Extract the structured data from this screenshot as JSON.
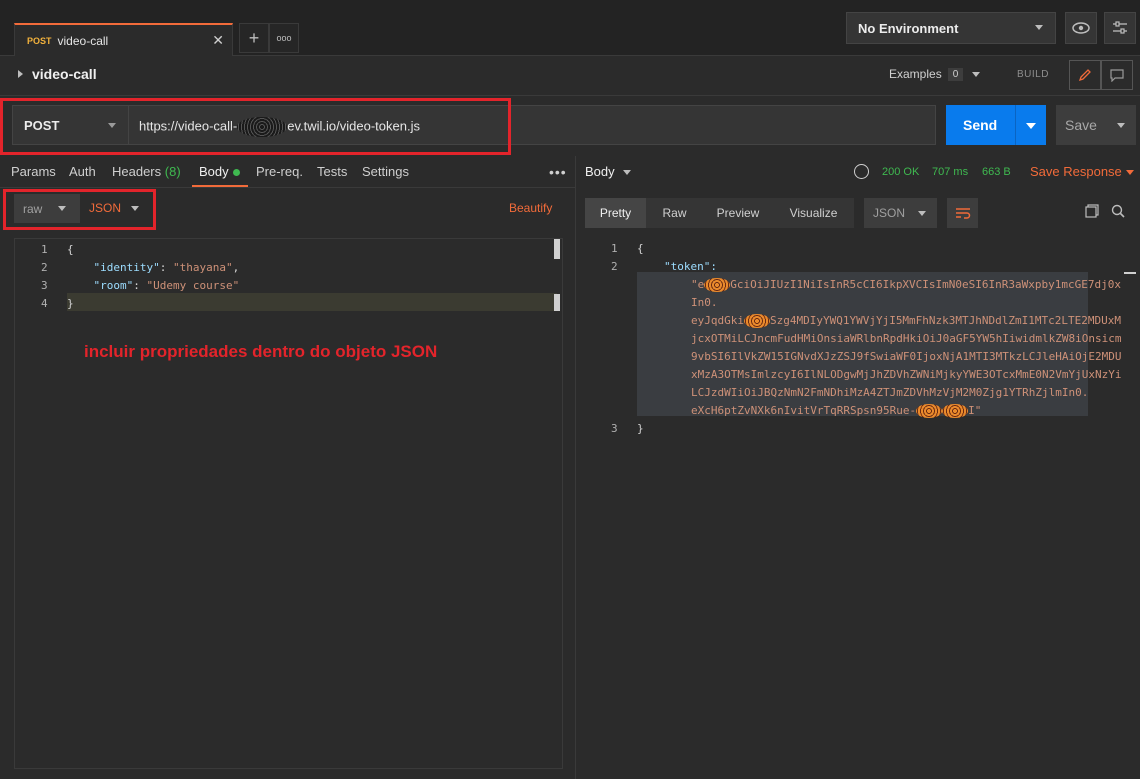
{
  "tabbar": {
    "tab_method": "POST",
    "tab_name": "video-call",
    "close_glyph": "✕",
    "new_tab_glyph": "+",
    "more_glyph": "ooo",
    "environment": "No Environment"
  },
  "request": {
    "title": "video-call",
    "examples_label": "Examples",
    "examples_count": "0",
    "build_label": "BUILD",
    "method": "POST",
    "url_prefix": "https://video-call-",
    "url_suffix": "ev.twil.io/video-token.js",
    "send_label": "Send",
    "save_label": "Save"
  },
  "request_tabs": [
    {
      "label": "Params"
    },
    {
      "label": "Auth"
    },
    {
      "label": "Headers",
      "count": "(8)"
    },
    {
      "label": "Body"
    },
    {
      "label": "Pre-req."
    },
    {
      "label": "Tests"
    },
    {
      "label": "Settings"
    }
  ],
  "body_options": {
    "mode": "raw",
    "format": "JSON",
    "beautify": "Beautify"
  },
  "request_body": {
    "line_numbers": [
      "1",
      "2",
      "3",
      "4"
    ],
    "open_brace": "{",
    "identity_key": "\"identity\"",
    "identity_value": "\"thayana\"",
    "room_key": "\"room\"",
    "room_value": "\"Udemy course\"",
    "close_brace": "}"
  },
  "annotation": "incluir propriedades dentro do objeto JSON",
  "response": {
    "body_label": "Body",
    "status": "200 OK",
    "time": "707 ms",
    "size": "663 B",
    "save_response": "Save Response",
    "view_tabs": [
      "Pretty",
      "Raw",
      "Preview",
      "Visualize"
    ],
    "format": "JSON",
    "line_numbers": [
      "1",
      "2",
      "3"
    ],
    "open_brace": "{",
    "token_key": "\"token\":",
    "token_lines": [
      "\"e",
      "GciOiJIUzI1NiIsInR5cCI6IkpXVCIsImN0eSI6InR3aWxpby1mcGE7dj0x",
      "In0.",
      "eyJqdGki",
      "Szg4MDIyYWQ1YWVjYjI5MmFhNzk3MTJhNDdlZmI1MTc2LTE2MDUxM",
      "jcxOTMiLCJncmFudHMiOnsiaWRlbnRpdHkiOiJ0aGF5YW5hIiwidmlkZW8iOnsicm",
      "9vbSI6IlVkZW15IGNvdXJzZSJ9fSwiaWF0IjoxNjA1MTI3MTkzLCJleHAiOjE2MDU",
      "xMzA3OTMsImlzcyI6IlNLODgwMjJhZDVhZWNiMjkyYWE3OTcxMmE0N2VmYjUxNzYi",
      "LCJzdWIiOiJBQzNmN2FmNDhiMzA4ZTJmZDVhMzVjM2M0Zjg1YTRhZjlmIn0.",
      "eXcH6ptZvNXk6nIvitVrTqRRSpsn95Rue-",
      "I\""
    ],
    "close_brace": "}"
  },
  "colors": {
    "accent": "#f26b3a",
    "send_blue": "#097bed",
    "annotation_red": "#e3242b",
    "status_green": "#3fb950"
  }
}
